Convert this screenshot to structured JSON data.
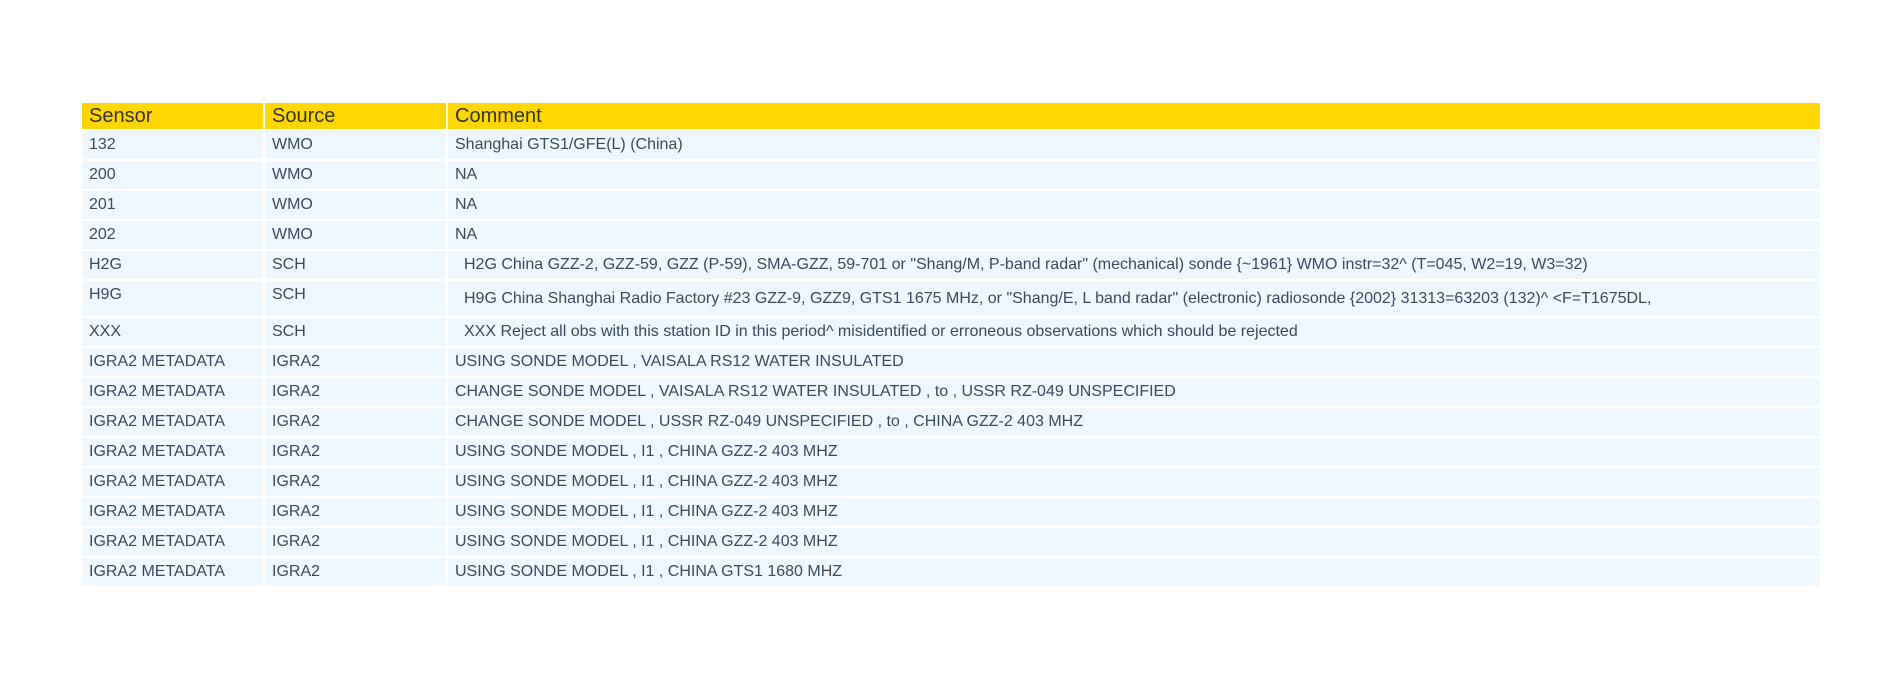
{
  "table": {
    "headers": [
      "Sensor",
      "Source",
      "Comment"
    ],
    "rows": [
      {
        "sensor": "132",
        "source": "WMO",
        "comment": "Shanghai GTS1/GFE(L) (China)"
      },
      {
        "sensor": "200",
        "source": "WMO",
        "comment": "NA"
      },
      {
        "sensor": "201",
        "source": "WMO",
        "comment": "NA"
      },
      {
        "sensor": "202",
        "source": "WMO",
        "comment": "NA"
      },
      {
        "sensor": "H2G",
        "source": "SCH",
        "comment": "H2G China GZZ-2, GZZ-59, GZZ (P-59), SMA-GZZ, 59-701 or \"Shang/M, P-band radar\" (mechanical) sonde {~1961} WMO instr=32^ (T=045, W2=19, W3=32)"
      },
      {
        "sensor": "H9G",
        "source": "SCH",
        "comment": "H9G China Shanghai Radio Factory #23 GZZ-9, GZZ9, GTS1 1675 MHz, or \"Shang/E, L band radar\" (electronic) radiosonde {2002} 31313=63203 (132)^ <F=T1675DL,"
      },
      {
        "sensor": "XXX",
        "source": "SCH",
        "comment": "XXX Reject all obs with this station ID in this period^ misidentified or erroneous observations which should be rejected"
      },
      {
        "sensor": "IGRA2 METADATA",
        "source": "IGRA2",
        "comment": "USING SONDE MODEL , VAISALA RS12 WATER INSULATED"
      },
      {
        "sensor": "IGRA2 METADATA",
        "source": "IGRA2",
        "comment": "CHANGE SONDE MODEL , VAISALA RS12 WATER INSULATED , to , USSR RZ-049 UNSPECIFIED"
      },
      {
        "sensor": "IGRA2 METADATA",
        "source": "IGRA2",
        "comment": "CHANGE SONDE MODEL , USSR RZ-049 UNSPECIFIED , to , CHINA GZZ-2 403 MHZ"
      },
      {
        "sensor": "IGRA2 METADATA",
        "source": "IGRA2",
        "comment": "USING SONDE MODEL , I1 , CHINA GZZ-2 403 MHZ"
      },
      {
        "sensor": "IGRA2 METADATA",
        "source": "IGRA2",
        "comment": "USING SONDE MODEL , I1 , CHINA GZZ-2 403 MHZ"
      },
      {
        "sensor": "IGRA2 METADATA",
        "source": "IGRA2",
        "comment": "USING SONDE MODEL , I1 , CHINA GZZ-2 403 MHZ"
      },
      {
        "sensor": "IGRA2 METADATA",
        "source": "IGRA2",
        "comment": "USING SONDE MODEL , I1 , CHINA GZZ-2 403 MHZ"
      },
      {
        "sensor": "IGRA2 METADATA",
        "source": "IGRA2",
        "comment": "USING SONDE MODEL , I1 , CHINA GTS1 1680 MHZ"
      }
    ]
  },
  "colors": {
    "header_bg": "#FFD700",
    "row_bg": "#EEF6FE",
    "text": "#3d4a5c"
  }
}
